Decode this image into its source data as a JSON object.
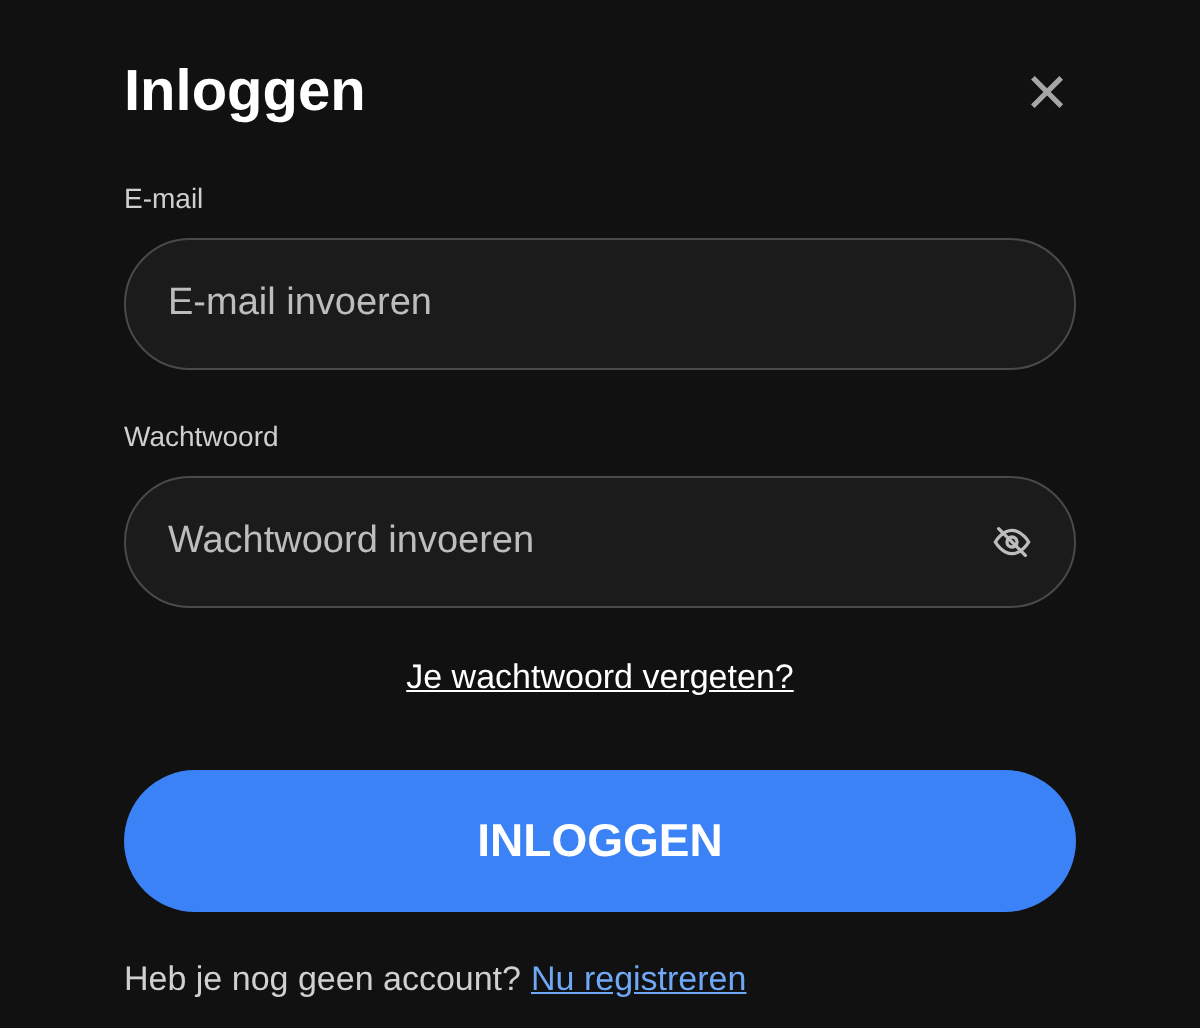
{
  "dialog": {
    "title": "Inloggen",
    "close": "×"
  },
  "fields": [
    {
      "kind": "email",
      "label": "E-mail",
      "placeholder": "E-mail invoeren"
    },
    {
      "kind": "password",
      "label": "Wachtwoord",
      "placeholder": "Wachtwoord invoeren",
      "password_visible": false
    }
  ],
  "forgot_link": "Je wachtwoord vergeten?",
  "submit_button": "INLOGGEN",
  "footer": {
    "text": "Heb je nog geen account?",
    "link": "Nu registreren"
  }
}
